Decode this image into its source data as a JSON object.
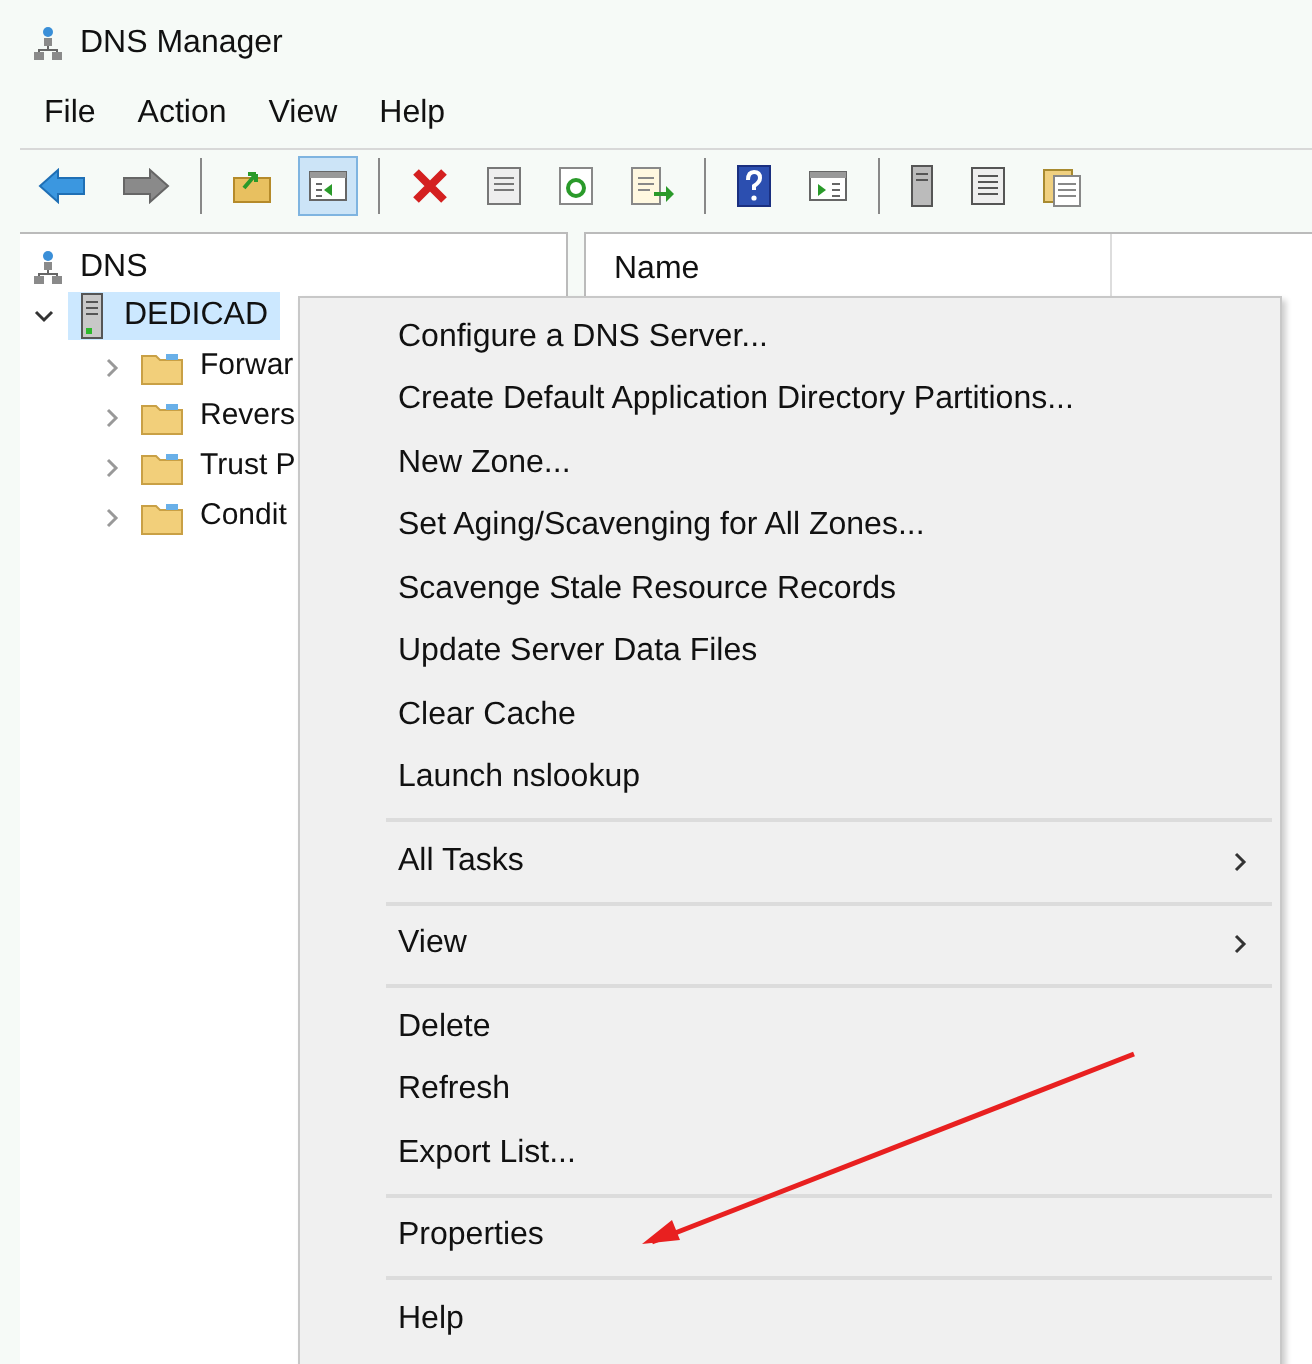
{
  "window": {
    "title": "DNS Manager"
  },
  "menu_bar": [
    "File",
    "Action",
    "View",
    "Help"
  ],
  "toolbar": [
    {
      "kind": "back",
      "selected": false
    },
    {
      "kind": "forward",
      "selected": false
    },
    {
      "kind": "sep"
    },
    {
      "kind": "up",
      "selected": false
    },
    {
      "kind": "tree",
      "selected": true
    },
    {
      "kind": "sep"
    },
    {
      "kind": "delete",
      "selected": false
    },
    {
      "kind": "properties",
      "selected": false
    },
    {
      "kind": "refresh",
      "selected": false
    },
    {
      "kind": "export",
      "selected": false
    },
    {
      "kind": "sep"
    },
    {
      "kind": "help",
      "selected": false
    },
    {
      "kind": "actionpane",
      "selected": false
    },
    {
      "kind": "sep"
    },
    {
      "kind": "server",
      "selected": false
    },
    {
      "kind": "list",
      "selected": false
    },
    {
      "kind": "clipboard",
      "selected": false
    }
  ],
  "tree": {
    "label": "DNS",
    "children": [
      {
        "label": "DEDICAD",
        "selected": true,
        "expanded": true,
        "children": [
          {
            "label": "Forwar",
            "expanded": false
          },
          {
            "label": "Revers",
            "expanded": false
          },
          {
            "label": "Trust P",
            "expanded": false
          },
          {
            "label": "Condit",
            "expanded": false
          }
        ]
      }
    ]
  },
  "list": {
    "columns": [
      "Name"
    ]
  },
  "context_menu": [
    [
      {
        "label": "Configure a DNS Server...",
        "submenu": false
      },
      {
        "label": "Create Default Application Directory Partitions...",
        "submenu": false
      },
      {
        "label": "New Zone...",
        "submenu": false
      },
      {
        "label": "Set Aging/Scavenging for All Zones...",
        "submenu": false
      },
      {
        "label": "Scavenge Stale Resource Records",
        "submenu": false
      },
      {
        "label": "Update Server Data Files",
        "submenu": false
      },
      {
        "label": "Clear Cache",
        "submenu": false
      },
      {
        "label": "Launch nslookup",
        "submenu": false
      }
    ],
    [
      {
        "label": "All Tasks",
        "submenu": true
      }
    ],
    [
      {
        "label": "View",
        "submenu": true
      }
    ],
    [
      {
        "label": "Delete",
        "submenu": false
      },
      {
        "label": "Refresh",
        "submenu": false
      },
      {
        "label": "Export List...",
        "submenu": false
      }
    ],
    [
      {
        "label": "Properties",
        "submenu": false
      }
    ],
    [
      {
        "label": "Help",
        "submenu": false
      }
    ]
  ]
}
